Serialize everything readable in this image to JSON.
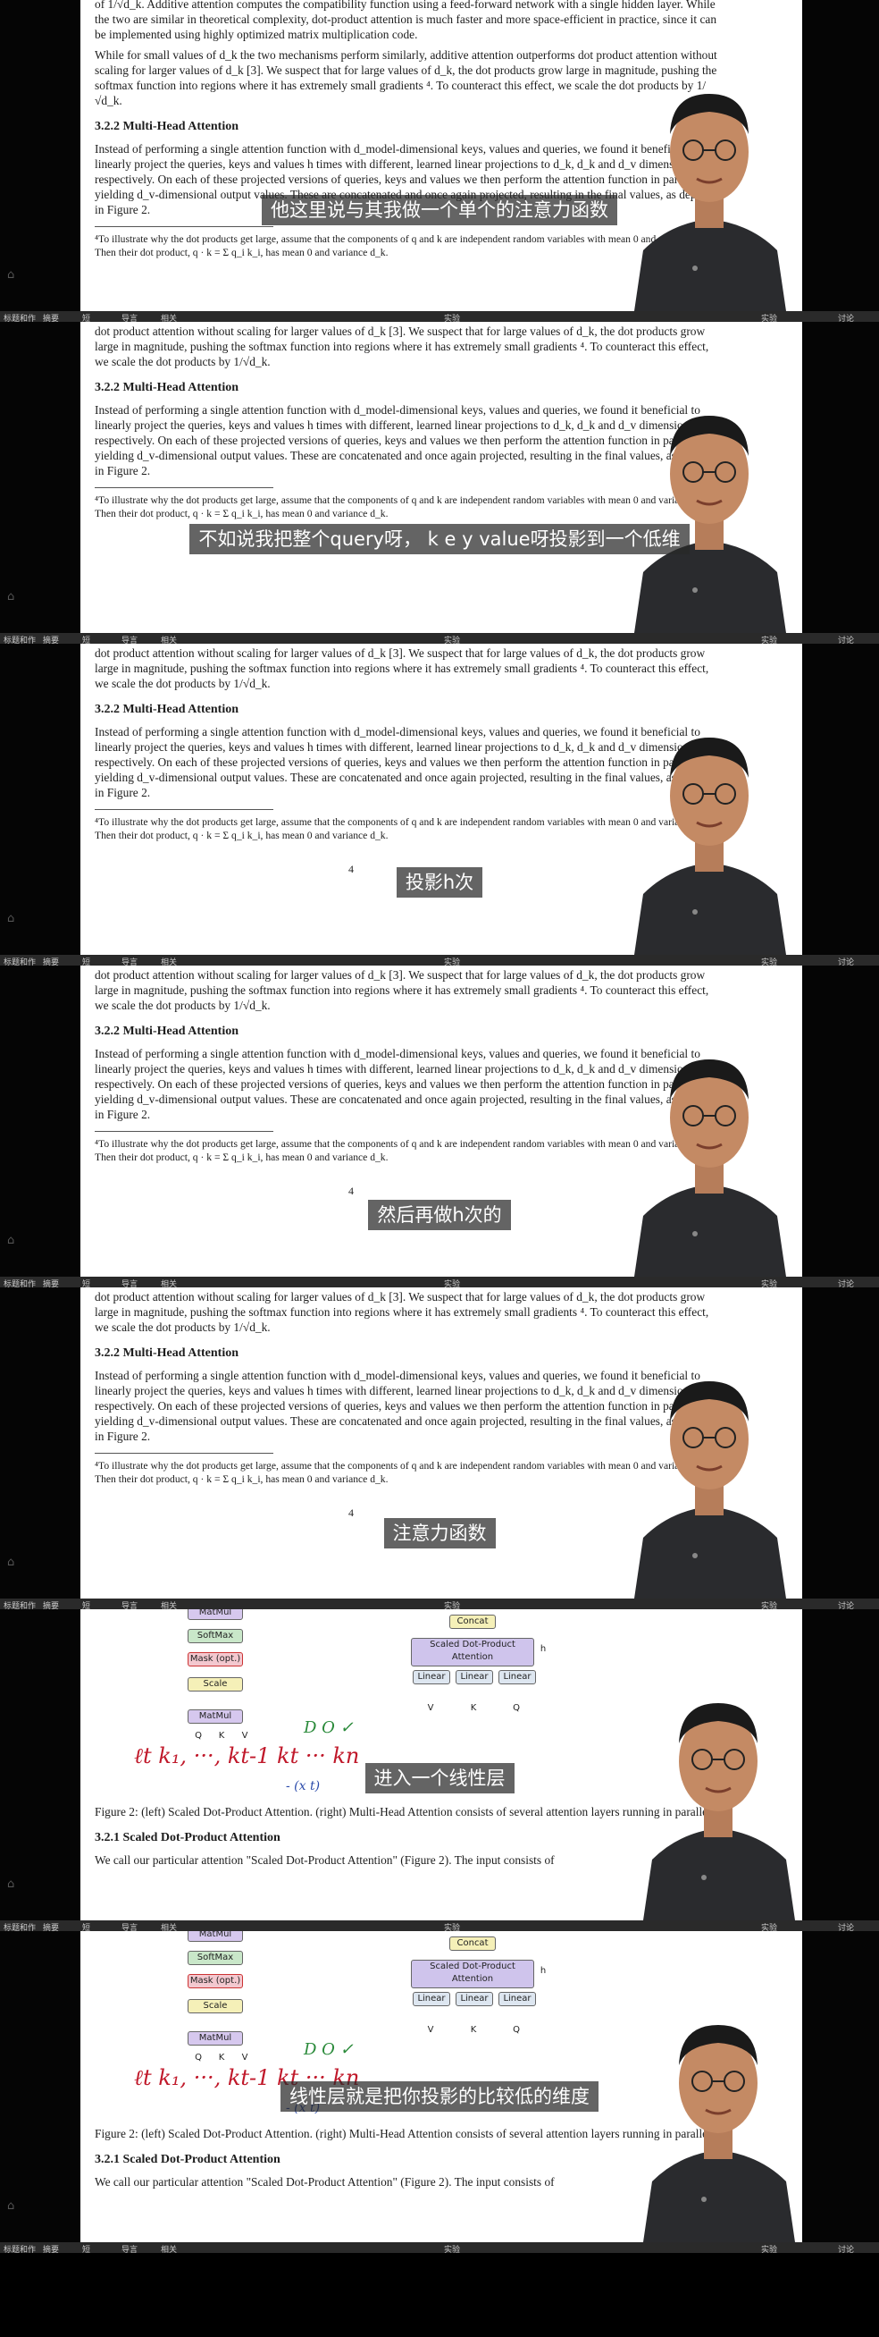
{
  "bar": {
    "left_items": [
      "标题和作",
      "摘要",
      "短",
      "导言",
      "相关"
    ],
    "mid": "实验",
    "right": "实验",
    "far_right": "讨论"
  },
  "paper": {
    "top_line": "of 1/√d_k. Additive attention computes the compatibility function using a feed-forward network with a single hidden layer. While the two are similar in theoretical complexity, dot-product attention is much faster and more space-efficient in practice, since it can be implemented using highly optimized matrix multiplication code.",
    "para_small": "While for small values of d_k the two mechanisms perform similarly, additive attention outperforms dot product attention without scaling for larger values of d_k [3]. We suspect that for large values of d_k, the dot products grow large in magnitude, pushing the softmax function into regions where it has extremely small gradients ⁴. To counteract this effect, we scale the dot products by 1/√d_k.",
    "para_dot": "dot product attention without scaling for larger values of d_k [3]. We suspect that for large values of d_k, the dot products grow large in magnitude, pushing the softmax function into regions where it has extremely small gradients ⁴. To counteract this effect, we scale the dot products by 1/√d_k.",
    "heading_multi": "3.2.2   Multi-Head Attention",
    "para_multi": "Instead of performing a single attention function with d_model-dimensional keys, values and queries, we found it beneficial to linearly project the queries, keys and values h times with different, learned linear projections to d_k, d_k and d_v dimensions, respectively. On each of these projected versions of queries, keys and values we then perform the attention function in parallel, yielding d_v-dimensional output values. These are concatenated and once again projected, resulting in the final values, as depicted in Figure 2.",
    "footnote": "⁴To illustrate why the dot products get large, assume that the components of q and k are independent random variables with mean 0 and variance 1. Then their dot product, q · k = Σ q_i k_i, has mean 0 and variance d_k.",
    "page_number": "4",
    "caption": "Figure 2: (left) Scaled Dot-Product Attention. (right) Multi-Head Attention consists of several attention layers running in parallel.",
    "heading_scaled": "3.2.1   Scaled Dot-Product Attention",
    "para_scaled": "We call our particular attention \"Scaled Dot-Product Attention\" (Figure 2). The input consists of"
  },
  "diagram": {
    "left_boxes": [
      "MatMul",
      "SoftMax",
      "Mask (opt.)",
      "Scale",
      "MatMul"
    ],
    "left_inputs": [
      "Q",
      "K",
      "V"
    ],
    "right_boxes": [
      "Concat",
      "Scaled Dot-Product Attention",
      "Linear",
      "Linear",
      "Linear"
    ],
    "right_inputs": [
      "V",
      "K",
      "Q"
    ],
    "h_label": "h",
    "hw_line1": "ℓt   k₁, ···, kt-1   kt ··· kn",
    "hw_line2": "D  O  ✓",
    "hw_line3": "- (x t)"
  },
  "subtitles": [
    "他这里说与其我做一个单个的注意力函数",
    "不如说我把整个query呀， k e y value呀投影到一个低维",
    "投影h次",
    "然后再做h次的",
    "注意力函数",
    "进入一个线性层",
    "线性层就是把你投影的比较低的维度"
  ]
}
